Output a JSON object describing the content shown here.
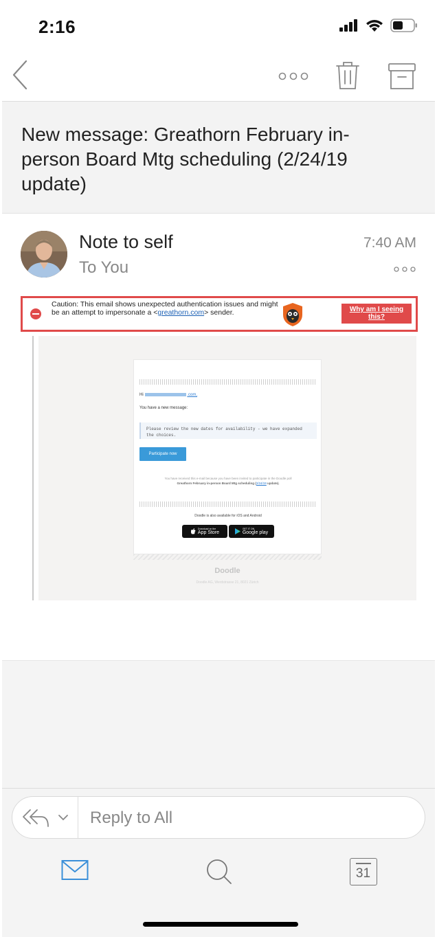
{
  "status_bar": {
    "time": "2:16"
  },
  "subject": "New message: Greathorn February  in-person Board Mtg scheduling (2/24/19 update)",
  "message": {
    "sender": "Note to self",
    "recipient": "To You",
    "time": "7:40 AM"
  },
  "caution": {
    "text_before": "Caution: This email shows unexpected authentication issues and might be an attempt to impersonate a <",
    "link": "greathorn.com",
    "text_after": "> sender.",
    "button": "Why am I seeing this?"
  },
  "email_body": {
    "greeting": "Hi",
    "greeting_end": ".com,",
    "intro": "You have a new message:",
    "quote": "Please review the new dates for availability - we have expanded the choices.",
    "button": "Participate now",
    "note_line1": "You have received this e-mail because you have been invited to participate in the Doodle poll",
    "note_bold": "Greathorn February in-person Board Mtg scheduling (",
    "note_link": "2/24/19",
    "note_end": " update).",
    "available": "Doodle is also available for iOS and Android",
    "appstore_small": "Download on the",
    "appstore": "App Store",
    "googleplay_small": "GET IT ON",
    "googleplay": "Google play",
    "footer_brand": "Doodle",
    "footer_address": "Doodle AG, Werdstrasse 21, 8021 Zürich"
  },
  "reply": {
    "label": "Reply to All"
  },
  "tabs": {
    "calendar_day": "31"
  },
  "colors": {
    "accent": "#3a8fd9",
    "caution": "#e04a4a",
    "text_secondary": "#888888"
  }
}
